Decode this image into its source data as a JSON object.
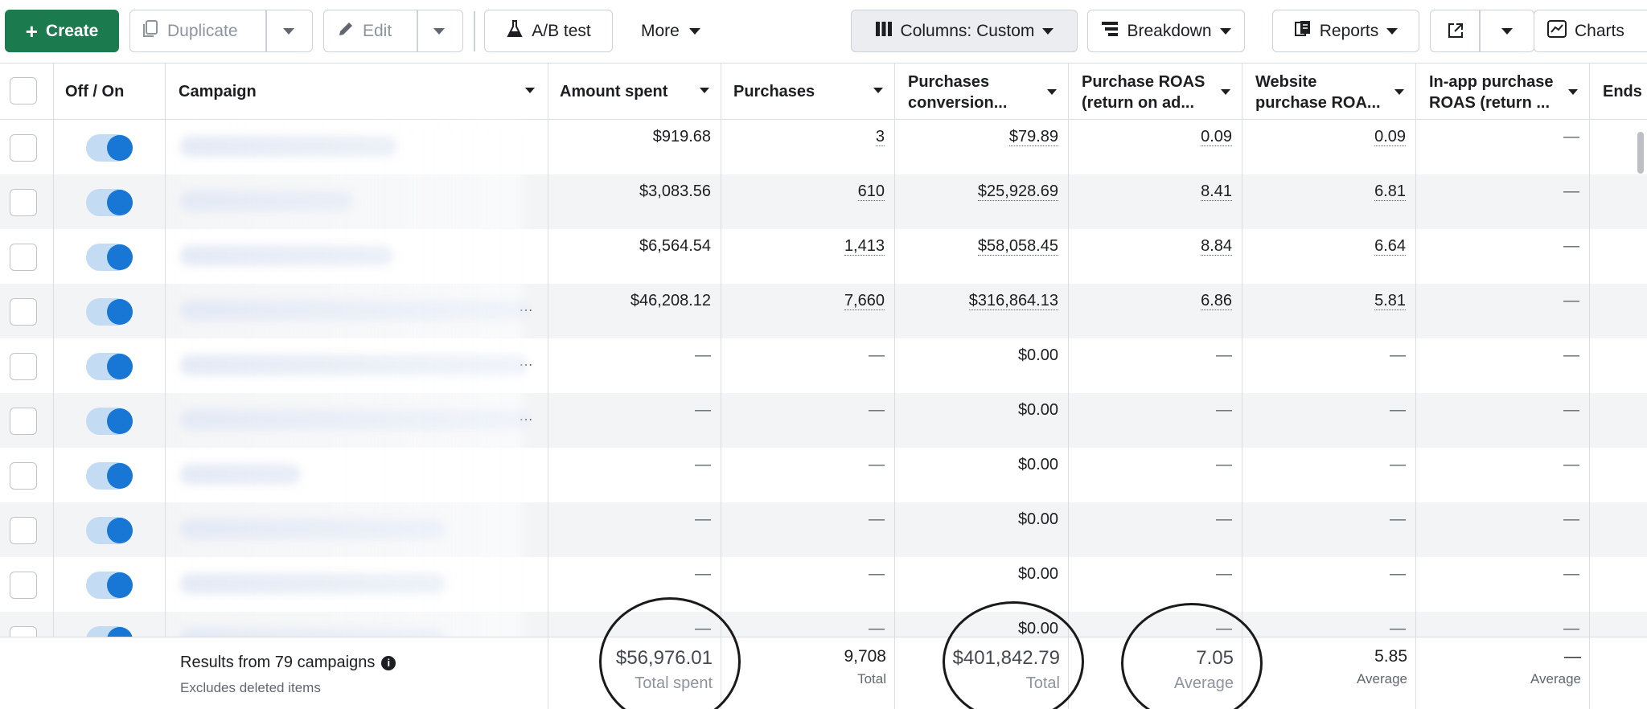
{
  "toolbar": {
    "create": "Create",
    "duplicate": "Duplicate",
    "edit": "Edit",
    "ab_test": "A/B test",
    "more": "More",
    "columns": "Columns: Custom",
    "breakdown": "Breakdown",
    "reports": "Reports",
    "charts": "Charts"
  },
  "columns": {
    "onoff": "Off / On",
    "campaign": "Campaign",
    "amount_spent": "Amount spent",
    "purchases": "Purchases",
    "conv_1": "Purchases",
    "conv_2": "conversion...",
    "roas_1": "Purchase ROAS",
    "roas_2": "(return on ad...",
    "web_1": "Website",
    "web_2": "purchase ROA...",
    "inapp_1": "In-app purchase",
    "inapp_2": "ROAS (return ...",
    "ends": "Ends"
  },
  "rows": [
    {
      "amount_spent": "$919.68",
      "purchases": "3",
      "conversion": "$79.89",
      "roas": "0.09",
      "website_roas": "0.09",
      "inapp": "—"
    },
    {
      "amount_spent": "$3,083.56",
      "purchases": "610",
      "conversion": "$25,928.69",
      "roas": "8.41",
      "website_roas": "6.81",
      "inapp": "—"
    },
    {
      "amount_spent": "$6,564.54",
      "purchases": "1,413",
      "conversion": "$58,058.45",
      "roas": "8.84",
      "website_roas": "6.64",
      "inapp": "—"
    },
    {
      "amount_spent": "$46,208.12",
      "purchases": "7,660",
      "conversion": "$316,864.13",
      "roas": "6.86",
      "website_roas": "5.81",
      "inapp": "—"
    },
    {
      "amount_spent": "—",
      "purchases": "—",
      "conversion": "$0.00",
      "roas": "—",
      "website_roas": "—",
      "inapp": "—"
    },
    {
      "amount_spent": "—",
      "purchases": "—",
      "conversion": "$0.00",
      "roas": "—",
      "website_roas": "—",
      "inapp": "—"
    },
    {
      "amount_spent": "—",
      "purchases": "—",
      "conversion": "$0.00",
      "roas": "—",
      "website_roas": "—",
      "inapp": "—"
    },
    {
      "amount_spent": "—",
      "purchases": "—",
      "conversion": "$0.00",
      "roas": "—",
      "website_roas": "—",
      "inapp": "—"
    },
    {
      "amount_spent": "—",
      "purchases": "—",
      "conversion": "$0.00",
      "roas": "—",
      "website_roas": "—",
      "inapp": "—"
    },
    {
      "amount_spent": "—",
      "purchases": "—",
      "conversion": "$0.00",
      "roas": "—",
      "website_roas": "—",
      "inapp": "—"
    }
  ],
  "footer": {
    "results": "Results from 79 campaigns",
    "excludes": "Excludes deleted items",
    "amount_spent": "$56,976.01",
    "amount_spent_label": "Total spent",
    "purchases": "9,708",
    "purchases_label": "Total",
    "conversion": "$401,842.79",
    "conversion_label": "Total",
    "roas": "7.05",
    "roas_label": "Average",
    "website_roas": "5.85",
    "website_roas_label": "Average",
    "inapp": "—",
    "inapp_label": "Average"
  },
  "colors": {
    "primary": "#1b7a4e",
    "toggle_on": "#1877d4"
  }
}
